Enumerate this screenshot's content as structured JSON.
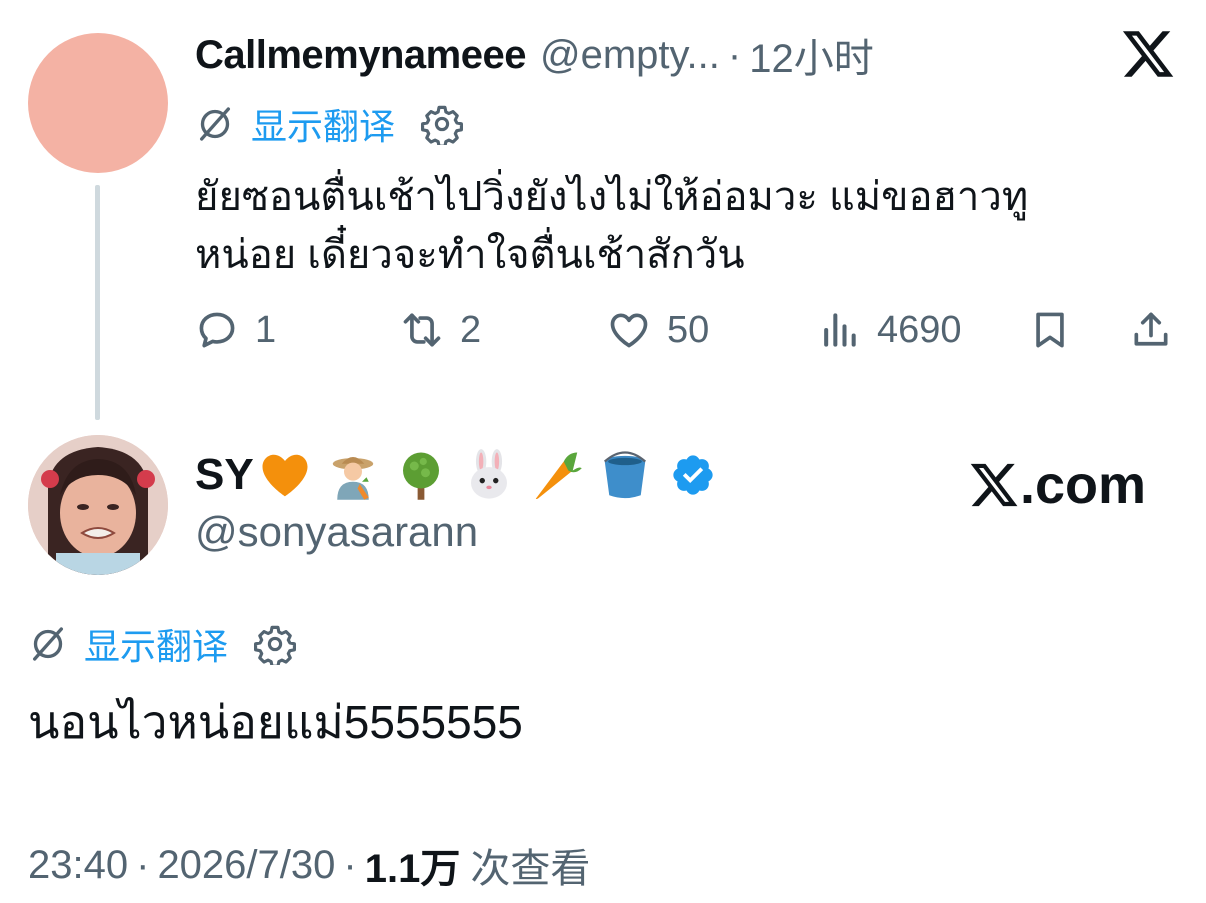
{
  "parent_tweet": {
    "display_name": "Callmemynameee",
    "handle": "@empty...",
    "separator": "·",
    "time": "12小时",
    "translate_label": "显示翻译",
    "text_line1": "ยัยซอนตื่นเช้าไปวิ่งยังไงไม่ให้อ่อมวะ แม่ขอฮาวทู",
    "text_line2": "หน่อย เดี๋ยวจะทำใจตื่นเช้าสักวัน",
    "actions": {
      "replies": "1",
      "retweets": "2",
      "likes": "50",
      "views": "4690"
    },
    "avatar_color": "#f4b2a4"
  },
  "main_tweet": {
    "display_name": "SY",
    "emojis": [
      "orange-heart",
      "farmer",
      "tree",
      "rabbit",
      "carrot",
      "bucket"
    ],
    "verified": true,
    "handle": "@sonyasarann",
    "translate_label": "显示翻译",
    "text": "นอนไวหน่อยแม่5555555",
    "time": "23:40",
    "date": "2026/7/30",
    "separator": "·",
    "views_count": "1.1万",
    "views_label": "次查看"
  },
  "branding": {
    "site_text": ".com"
  },
  "colors": {
    "accent": "#1d9bf0",
    "secondary_text": "#536471",
    "thread_line": "#cfd9de"
  }
}
